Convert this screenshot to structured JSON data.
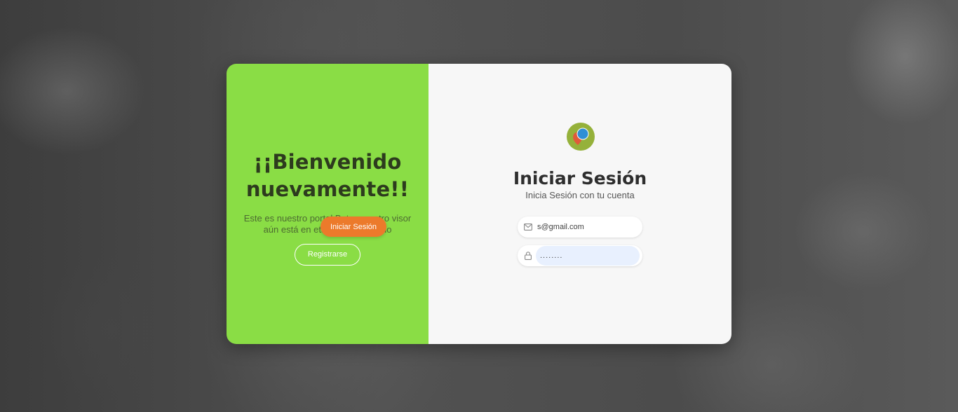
{
  "welcome_panel": {
    "heading": "¡¡Bienvenido nuevamente!!",
    "description": "Este es nuestro portal Beta, nuestro visor aún está en etapa de desarrollo",
    "register_label": "Registrarse",
    "background_color": "#8add45"
  },
  "login_panel": {
    "title": "Iniciar Sesión",
    "subtitle": "Inicia Sesión con tu cuenta",
    "email": {
      "value": "s@gmail.com",
      "icon": "mail-icon"
    },
    "password": {
      "value": "........",
      "icon": "lock-icon"
    },
    "submit_label": "Iniciar Sesión",
    "submit_color": "#ec7a2b"
  }
}
